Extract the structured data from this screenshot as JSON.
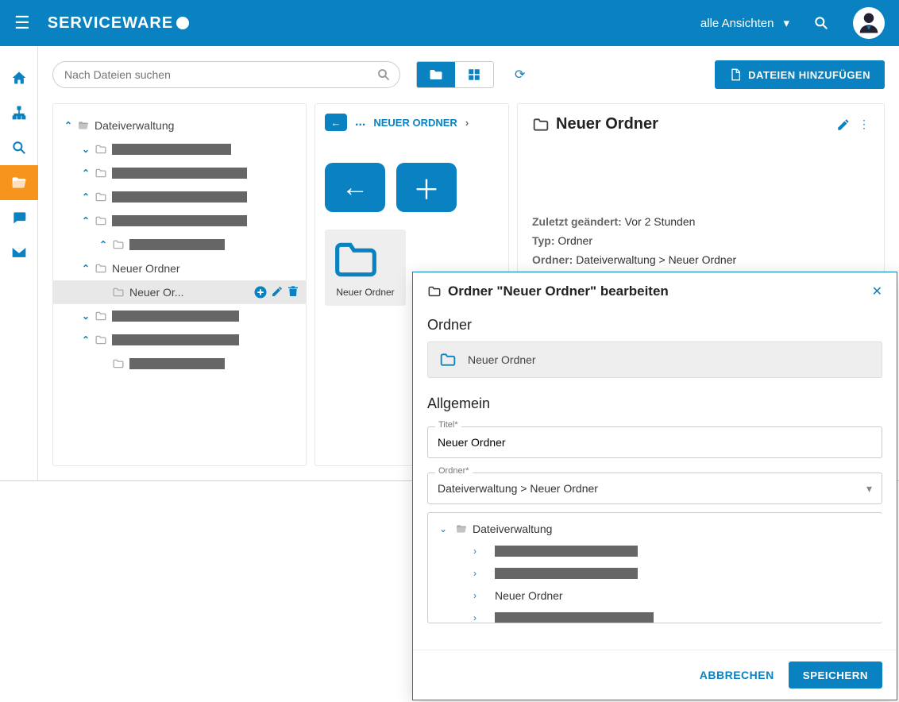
{
  "topbar": {
    "brand": "SERVICEWARE",
    "view_selector": "alle Ansichten"
  },
  "search": {
    "placeholder": "Nach Dateien suchen"
  },
  "toolbar": {
    "add_files": "DATEIEN HINZUFÜGEN"
  },
  "tree": {
    "root": "Dateiverwaltung",
    "new_folder": "Neuer Ordner",
    "new_or": "Neuer Or..."
  },
  "breadcrumb": {
    "dots": "...",
    "label": "NEUER ORDNER"
  },
  "tile": {
    "label": "Neuer Ordner"
  },
  "detail": {
    "title": "Neuer Ordner",
    "last_modified_label": "Zuletzt geändert:",
    "last_modified_value": "Vor 2 Stunden",
    "type_label": "Typ:",
    "type_value": "Ordner",
    "path_label": "Ordner:",
    "path_value": "Dateiverwaltung > Neuer Ordner"
  },
  "dialog": {
    "title": "Ordner \"Neuer Ordner\" bearbeiten",
    "sec_folder": "Ordner",
    "chip_label": "Neuer Ordner",
    "sec_general": "Allgemein",
    "title_field_label": "Titel*",
    "title_field_value": "Neuer Ordner",
    "folder_field_label": "Ordner*",
    "folder_field_value": "Dateiverwaltung > Neuer Ordner",
    "tree_root": "Dateiverwaltung",
    "tree_item": "Neuer Ordner",
    "cancel": "ABBRECHEN",
    "save": "SPEICHERN"
  }
}
